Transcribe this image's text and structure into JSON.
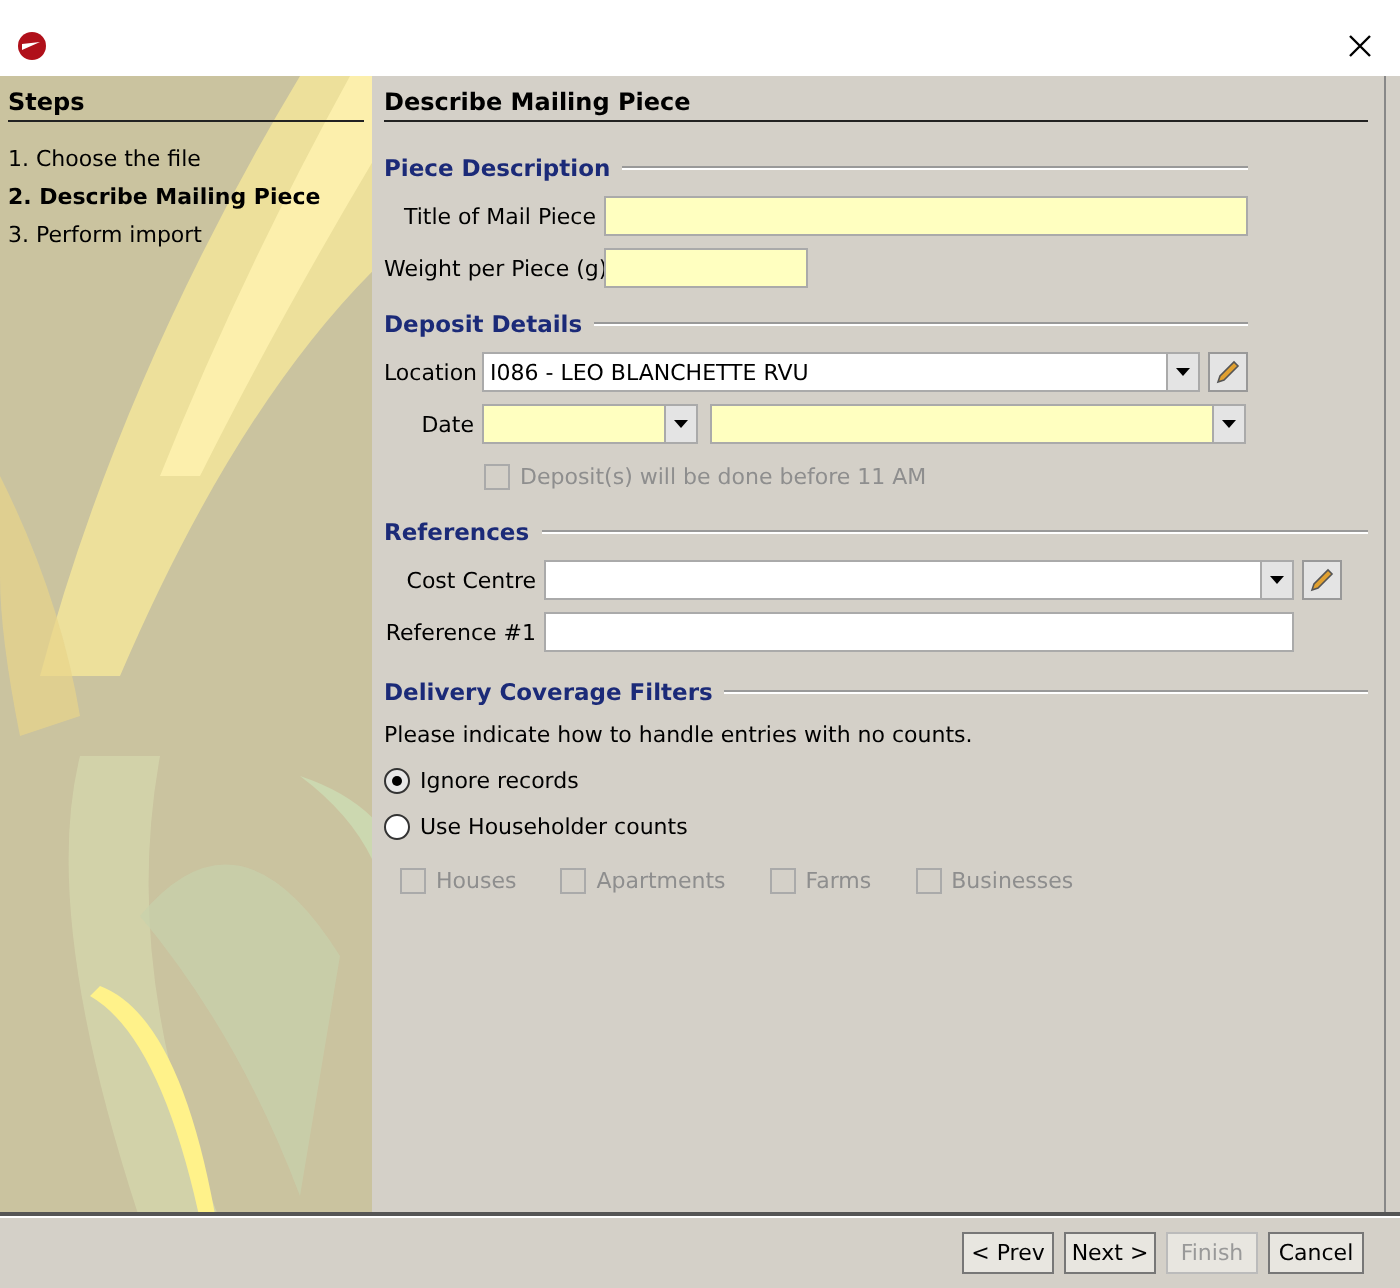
{
  "steps": {
    "heading": "Steps",
    "items": [
      {
        "label": "1. Choose the file",
        "selected": false
      },
      {
        "label": "2. Describe Mailing Piece",
        "selected": true
      },
      {
        "label": "3. Perform import",
        "selected": false
      }
    ]
  },
  "page_title": "Describe Mailing Piece",
  "piece_description": {
    "title": "Piece Description",
    "title_label": "Title of Mail Piece",
    "weight_label": "Weight per Piece (g)"
  },
  "deposit_details": {
    "title": "Deposit Details",
    "location_label": "Location",
    "location_value": "I086 - LEO BLANCHETTE RVU",
    "date_label": "Date",
    "before_11": {
      "label": "Deposit(s) will be done before 11 AM",
      "checked": false,
      "disabled": true
    }
  },
  "references": {
    "title": "References",
    "cost_centre_label": "Cost Centre",
    "reference_label": "Reference #1"
  },
  "coverage": {
    "title": "Delivery Coverage Filters",
    "instruction": "Please indicate how to handle entries with no counts.",
    "options": [
      {
        "label": "Ignore records",
        "selected": true
      },
      {
        "label": "Use Householder counts",
        "selected": false
      }
    ],
    "types": [
      {
        "label": "Houses",
        "checked": false,
        "disabled": true
      },
      {
        "label": "Apartments",
        "checked": false,
        "disabled": true
      },
      {
        "label": "Farms",
        "checked": false,
        "disabled": true
      },
      {
        "label": "Businesses",
        "checked": false,
        "disabled": true
      }
    ]
  },
  "buttons": [
    {
      "label": "< Prev",
      "disabled": false
    },
    {
      "label": "Next >",
      "disabled": false
    },
    {
      "label": "Finish",
      "disabled": true
    },
    {
      "label": "Cancel",
      "disabled": false
    }
  ]
}
